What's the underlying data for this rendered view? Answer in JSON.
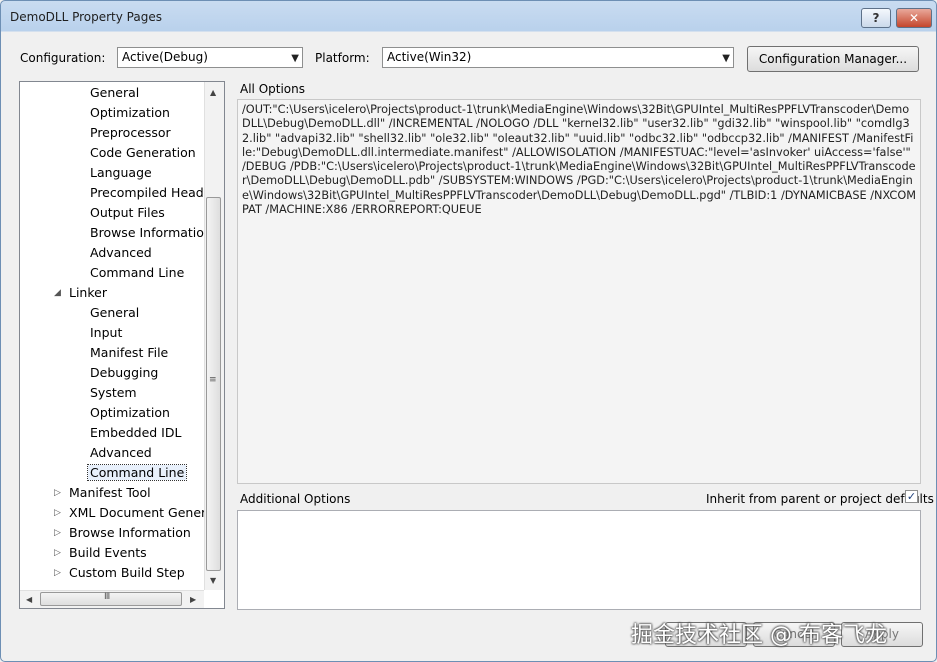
{
  "window": {
    "title": "DemoDLL Property Pages",
    "help": "?",
    "close": "✕"
  },
  "configuration": {
    "label": "Configuration:",
    "value": "Active(Debug)"
  },
  "platform": {
    "label": "Platform:",
    "value": "Active(Win32)"
  },
  "config_manager_label": "Configuration Manager...",
  "tree": {
    "items": [
      {
        "label": "General",
        "level": 2
      },
      {
        "label": "Optimization",
        "level": 2
      },
      {
        "label": "Preprocessor",
        "level": 2
      },
      {
        "label": "Code Generation",
        "level": 2
      },
      {
        "label": "Language",
        "level": 2
      },
      {
        "label": "Precompiled Heade",
        "level": 2
      },
      {
        "label": "Output Files",
        "level": 2
      },
      {
        "label": "Browse Information",
        "level": 2
      },
      {
        "label": "Advanced",
        "level": 2
      },
      {
        "label": "Command Line",
        "level": 2
      },
      {
        "label": "Linker",
        "level": 1,
        "expander": "◢"
      },
      {
        "label": "General",
        "level": 2
      },
      {
        "label": "Input",
        "level": 2
      },
      {
        "label": "Manifest File",
        "level": 2
      },
      {
        "label": "Debugging",
        "level": 2
      },
      {
        "label": "System",
        "level": 2
      },
      {
        "label": "Optimization",
        "level": 2
      },
      {
        "label": "Embedded IDL",
        "level": 2
      },
      {
        "label": "Advanced",
        "level": 2
      },
      {
        "label": "Command Line",
        "level": 2,
        "selected": true
      },
      {
        "label": "Manifest Tool",
        "level": 1,
        "expander": "▷"
      },
      {
        "label": "XML Document Genera",
        "level": 1,
        "expander": "▷"
      },
      {
        "label": "Browse Information",
        "level": 1,
        "expander": "▷"
      },
      {
        "label": "Build Events",
        "level": 1,
        "expander": "▷"
      },
      {
        "label": "Custom Build Step",
        "level": 1,
        "expander": "▷"
      }
    ]
  },
  "all_options": {
    "label": "All Options",
    "text": "/OUT:\"C:\\Users\\icelero\\Projects\\product-1\\trunk\\MediaEngine\\Windows\\32Bit\\GPUIntel_MultiResPPFLVTranscoder\\DemoDLL\\Debug\\DemoDLL.dll\" /INCREMENTAL /NOLOGO /DLL \"kernel32.lib\" \"user32.lib\" \"gdi32.lib\" \"winspool.lib\" \"comdlg32.lib\" \"advapi32.lib\" \"shell32.lib\" \"ole32.lib\" \"oleaut32.lib\" \"uuid.lib\" \"odbc32.lib\" \"odbccp32.lib\" /MANIFEST /ManifestFile:\"Debug\\DemoDLL.dll.intermediate.manifest\" /ALLOWISOLATION /MANIFESTUAC:\"level='asInvoker' uiAccess='false'\" /DEBUG /PDB:\"C:\\Users\\icelero\\Projects\\product-1\\trunk\\MediaEngine\\Windows\\32Bit\\GPUIntel_MultiResPPFLVTranscoder\\DemoDLL\\Debug\\DemoDLL.pdb\" /SUBSYSTEM:WINDOWS /PGD:\"C:\\Users\\icelero\\Projects\\product-1\\trunk\\MediaEngine\\Windows\\32Bit\\GPUIntel_MultiResPPFLVTranscoder\\DemoDLL\\Debug\\DemoDLL.pgd\" /TLBID:1 /DYNAMICBASE /NXCOMPAT /MACHINE:X86 /ERRORREPORT:QUEUE"
  },
  "additional_options": {
    "label": "Additional Options",
    "value": "",
    "inherit_label": "Inherit from parent or project defaults",
    "inherit_checked": "✓"
  },
  "buttons": {
    "ok": "OK",
    "cancel": "Cancel",
    "apply": "Apply"
  },
  "watermark": "掘金技术社区 @ 布客飞龙"
}
